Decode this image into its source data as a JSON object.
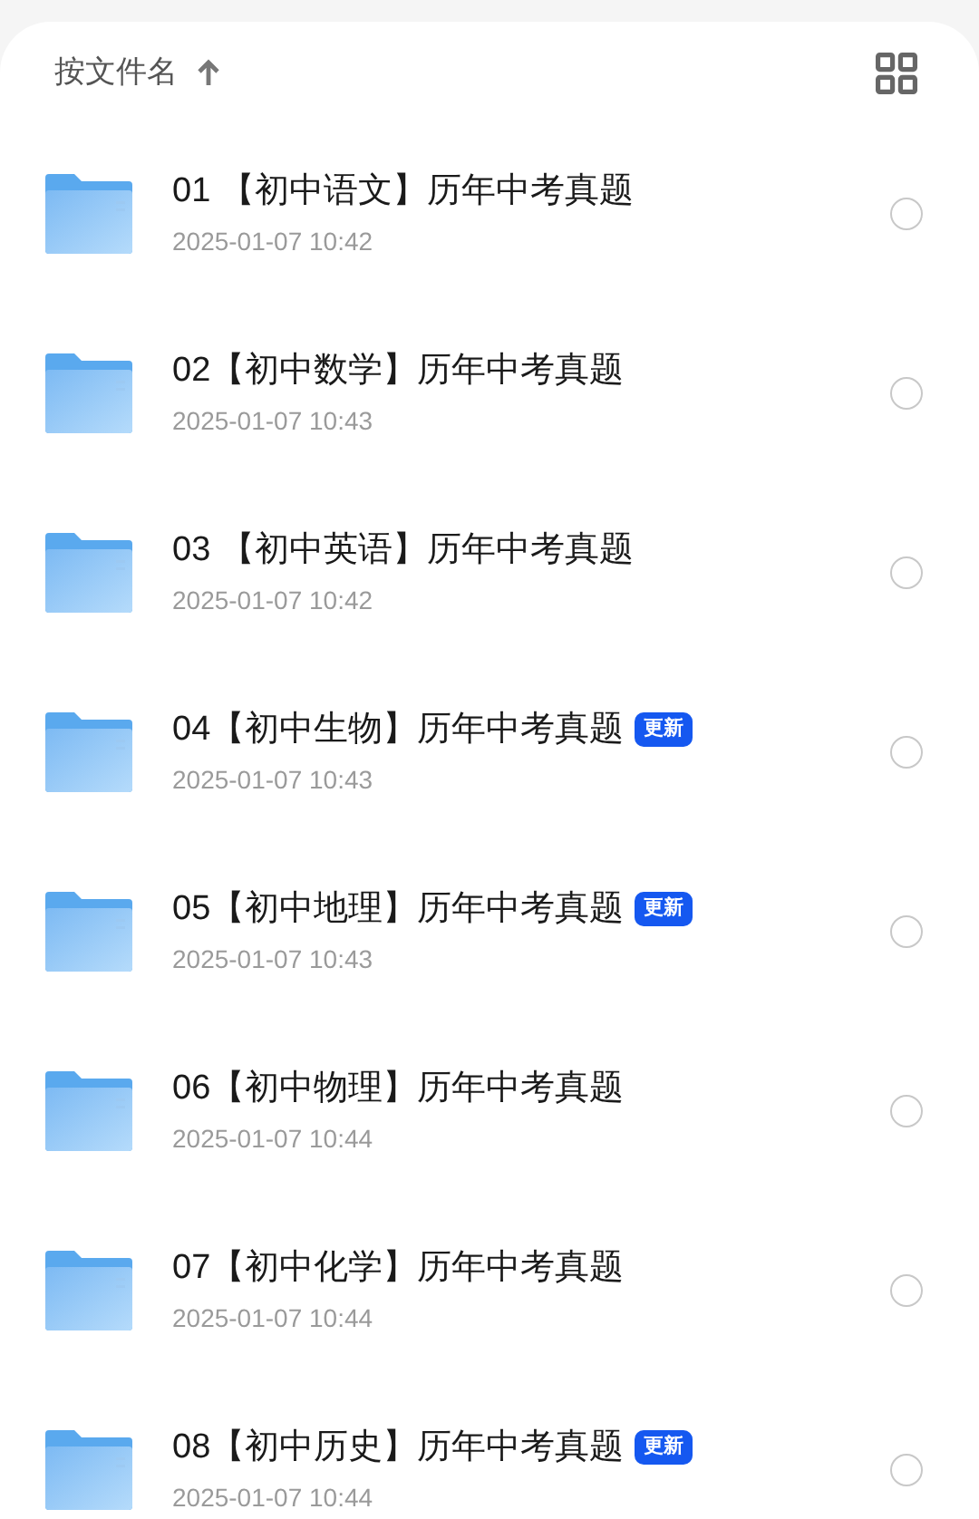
{
  "sort_bar": {
    "label": "按文件名",
    "ascending": true
  },
  "files": [
    {
      "name": "01 【初中语文】历年中考真题",
      "date": "2025-01-07 10:42",
      "selected": false
    },
    {
      "name": "02【初中数学】历年中考真题",
      "date": "2025-01-07 10:43",
      "selected": false
    },
    {
      "name": "03 【初中英语】历年中考真题",
      "date": "2025-01-07 10:42",
      "selected": false
    },
    {
      "name": "04【初中生物】历年中考真题",
      "date": "2025-01-07 10:43",
      "badge": "更新",
      "selected": false
    },
    {
      "name": "05【初中地理】历年中考真题",
      "date": "2025-01-07 10:43",
      "badge": "更新",
      "selected": false
    },
    {
      "name": "06【初中物理】历年中考真题",
      "date": "2025-01-07 10:44",
      "selected": false
    },
    {
      "name": "07【初中化学】历年中考真题",
      "date": "2025-01-07 10:44",
      "selected": false
    },
    {
      "name": "08【初中历史】历年中考真题",
      "date": "2025-01-07 10:44",
      "badge": "更新",
      "selected": false
    }
  ]
}
